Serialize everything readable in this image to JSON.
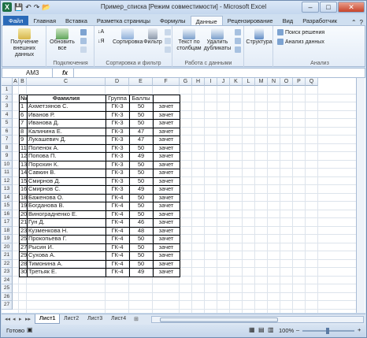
{
  "window": {
    "title": "Пример_списка [Режим совместимости] - Microsoft Excel",
    "min_label": "–",
    "max_label": "□",
    "close_label": "✕"
  },
  "tabs": [
    "Файл",
    "Главная",
    "Вставка",
    "Разметка страницы",
    "Формулы",
    "Данные",
    "Рецензирование",
    "Вид",
    "Разработчик"
  ],
  "active_tab": "Данные",
  "ribbon": {
    "get_data": "Получение внешних данных",
    "refresh_all": "Обновить все",
    "connections_group": "Подключения",
    "sort": "Сортировка",
    "filter": "Фильтр",
    "sort_filter_group": "Сортировка и фильтр",
    "text_to_columns": "Текст по столбцам",
    "remove_duplicates": "Удалить дубликаты",
    "data_tools_group": "Работа с данными",
    "outline": "Структура",
    "solver": "Поиск решения",
    "data_analysis": "Анализ данных",
    "analysis_group": "Анализ"
  },
  "formula_bar": {
    "name_box": "AM3",
    "fx": "fx",
    "value": ""
  },
  "columns": [
    "A",
    "B",
    "C",
    "D",
    "E",
    "F",
    "G",
    "H",
    "I",
    "J",
    "K",
    "L",
    "M",
    "N",
    "O",
    "P",
    "Q"
  ],
  "rows": [
    "1",
    "2",
    "3",
    "4",
    "5",
    "6",
    "7",
    "8",
    "9",
    "10",
    "11",
    "12",
    "13",
    "14",
    "15",
    "16",
    "17",
    "18",
    "19",
    "20",
    "21",
    "22",
    "23",
    "24",
    "25",
    "26",
    "27"
  ],
  "table": {
    "headers": [
      "№",
      "Фамилия",
      "Группа",
      "Баллы",
      ""
    ],
    "records": [
      [
        "1",
        "Ахметзянов С.",
        "ГК-3",
        "50",
        "зачет"
      ],
      [
        "6",
        "Иванов Р.",
        "ГК-3",
        "50",
        "зачет"
      ],
      [
        "7",
        "Иванова Д.",
        "ГК-3",
        "50",
        "зачет"
      ],
      [
        "8",
        "Калинина Е.",
        "ГК-3",
        "47",
        "зачет"
      ],
      [
        "9",
        "Лукашевич Д.",
        "ГК-3",
        "47",
        "зачет"
      ],
      [
        "11",
        "Поленок А.",
        "ГК-3",
        "50",
        "зачет"
      ],
      [
        "12",
        "Попова П.",
        "ГК-3",
        "49",
        "зачет"
      ],
      [
        "13",
        "Порохин К.",
        "ГК-3",
        "50",
        "зачет"
      ],
      [
        "14",
        "Савкин В.",
        "ГК-3",
        "50",
        "зачет"
      ],
      [
        "15",
        "Смирнов Д.",
        "ГК-3",
        "50",
        "зачет"
      ],
      [
        "16",
        "Смирнов С.",
        "ГК-3",
        "49",
        "зачет"
      ],
      [
        "18",
        "Баженова О.",
        "ГК-4",
        "50",
        "зачет"
      ],
      [
        "19",
        "Богданова В.",
        "ГК-4",
        "50",
        "зачет"
      ],
      [
        "20",
        "Виноградненко Е.",
        "ГК-4",
        "50",
        "зачет"
      ],
      [
        "21",
        "Гун Д.",
        "ГК-4",
        "46",
        "зачет"
      ],
      [
        "23",
        "Кузменкова Н.",
        "ГК-4",
        "48",
        "зачет"
      ],
      [
        "25",
        "Прокопьева Г.",
        "ГК-4",
        "50",
        "зачет"
      ],
      [
        "27",
        "Рысин И.",
        "ГК-4",
        "50",
        "зачет"
      ],
      [
        "29",
        "Сухова А.",
        "ГК-4",
        "50",
        "зачет"
      ],
      [
        "28",
        "Тимонина А.",
        "ГК-4",
        "50",
        "зачет"
      ],
      [
        "30",
        "Третьяк Е.",
        "ГК-4",
        "49",
        "зачет"
      ]
    ]
  },
  "sheets": [
    "Лист1",
    "Лист2",
    "Лист3",
    "Лист4"
  ],
  "active_sheet": "Лист1",
  "status": {
    "ready": "Готово",
    "zoom": "100%",
    "zoom_minus": "–",
    "zoom_plus": "+"
  },
  "colors": {
    "file_tab": "#2a6ab8",
    "excel_green": "#1e7145",
    "ribbon_bg": "#e3ecf7"
  }
}
